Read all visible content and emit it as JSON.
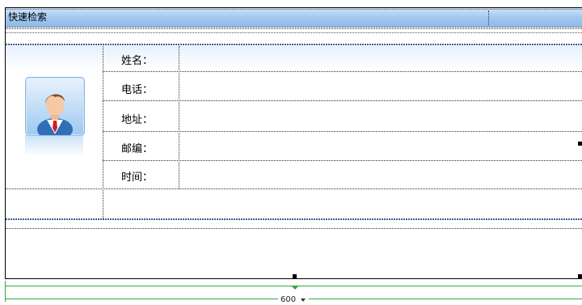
{
  "panel": {
    "title": "快速检索"
  },
  "form": {
    "fields": [
      {
        "label": "姓名：",
        "value": ""
      },
      {
        "label": "电话：",
        "value": ""
      },
      {
        "label": "地址：",
        "value": ""
      },
      {
        "label": "邮编：",
        "value": ""
      },
      {
        "label": "时间：",
        "value": ""
      }
    ]
  },
  "ruler": {
    "width_label": "600"
  },
  "colors": {
    "title_bar": "#9fc6ef",
    "border": "#000000",
    "ruler_line": "#39a83b"
  },
  "icons": {
    "avatar": "user-avatar-icon"
  }
}
